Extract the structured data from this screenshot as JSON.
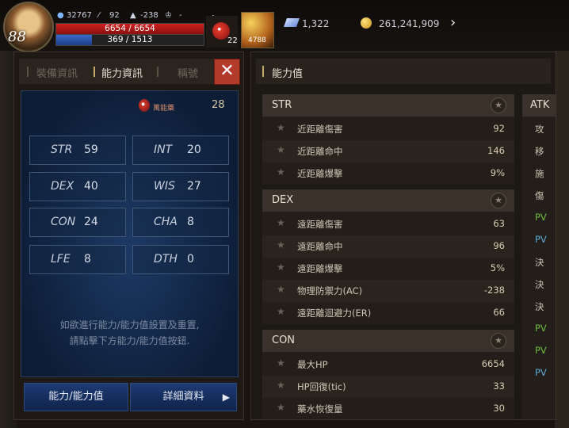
{
  "hud": {
    "level": "88",
    "stat_a": "32767",
    "stat_b": "92",
    "stat_c": "-238",
    "stat_d": "-",
    "hp": "6654 / 6654",
    "mp": "369 / 1513",
    "mp_fraction": 0.244,
    "potion_count": "22",
    "skill_count": "4788",
    "gems": "1,322",
    "gold": "261,241,909"
  },
  "left_panel": {
    "tabs": [
      "裝備資訊",
      "能力資訊",
      "稱號"
    ],
    "active_tab": 1,
    "close": "✕",
    "points_label": "萬能藥",
    "points_value": "28",
    "stats": [
      {
        "name": "STR",
        "value": "59"
      },
      {
        "name": "INT",
        "value": "20"
      },
      {
        "name": "DEX",
        "value": "40"
      },
      {
        "name": "WIS",
        "value": "27"
      },
      {
        "name": "CON",
        "value": "24"
      },
      {
        "name": "CHA",
        "value": "8"
      },
      {
        "name": "LFE",
        "value": "8"
      },
      {
        "name": "DTH",
        "value": "0"
      }
    ],
    "hint_line1": "如欲進行能力/能力值設置及重置,",
    "hint_line2": "請點擊下方能力/能力值按鈕.",
    "btn_ability": "能力/能力值",
    "btn_detail": "詳細資料"
  },
  "right_panel": {
    "title": "能力值",
    "sections": [
      {
        "title": "STR",
        "rows": [
          {
            "label": "近距離傷害",
            "value": "92"
          },
          {
            "label": "近距離命中",
            "value": "146"
          },
          {
            "label": "近距離爆擊",
            "value": "9%"
          }
        ]
      },
      {
        "title": "DEX",
        "rows": [
          {
            "label": "遠距離傷害",
            "value": "63"
          },
          {
            "label": "遠距離命中",
            "value": "96"
          },
          {
            "label": "遠距離爆擊",
            "value": "5%"
          },
          {
            "label": "物理防禦力(AC)",
            "value": "-238"
          },
          {
            "label": "遠距離迴避力(ER)",
            "value": "66"
          }
        ]
      },
      {
        "title": "CON",
        "rows": [
          {
            "label": "最大HP",
            "value": "6654"
          },
          {
            "label": "HP回復(tic)",
            "value": "33"
          },
          {
            "label": "藥水恢復量",
            "value": "30"
          }
        ]
      }
    ],
    "atk_title": "ATK",
    "atk_items": [
      "攻",
      "移",
      "施",
      "傷",
      "PV",
      "PV",
      "決",
      "決",
      "決",
      "PV",
      "PV",
      "PV"
    ]
  },
  "colors": {
    "accent": "#c7a86a",
    "close": "#b23b2c",
    "pvp_green": "#6dbb3c",
    "pvp_blue": "#5aa8d8"
  }
}
